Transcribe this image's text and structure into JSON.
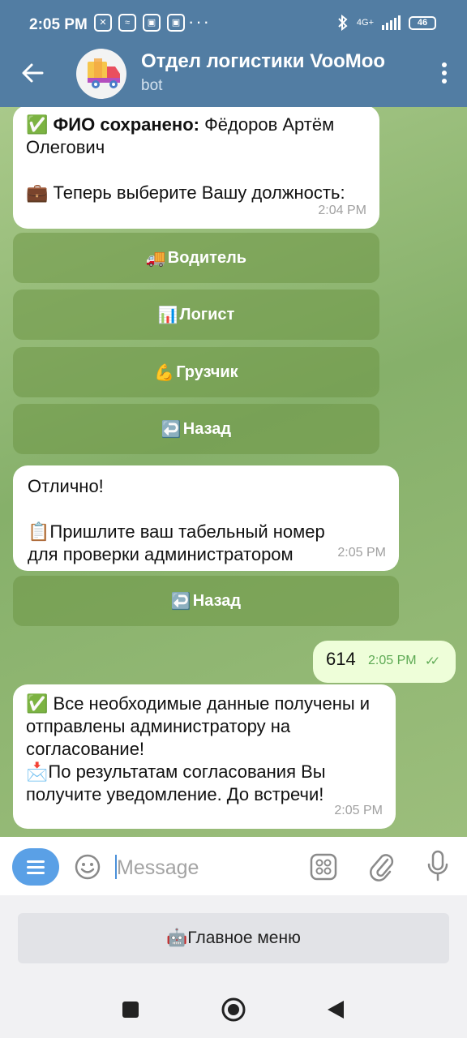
{
  "status_bar": {
    "time": "2:05 PM",
    "network": "4G+",
    "battery": "46"
  },
  "header": {
    "title": "Отдел логистики VooMoo",
    "subtitle": "bot"
  },
  "messages": {
    "m1": {
      "line1_bold": "ФИО сохранено:",
      "line1_rest": " Фёдоров Артём Олегович",
      "line2": "Теперь выберите Вашу должность:",
      "time": "2:04 PM",
      "buttons": [
        "Водитель",
        "Логист",
        "Грузчик",
        "Назад"
      ]
    },
    "m2": {
      "line1": "Отлично!",
      "line2": "Пришлите ваш табельный номер для проверки администратором",
      "time": "2:05 PM",
      "button": "Назад"
    },
    "m3": {
      "text": "614",
      "time": "2:05 PM"
    },
    "m4": {
      "line1": "Все необходимые данные получены и отправлены администратору на согласование!",
      "line2": "По результатам согласования Вы получите уведомление. До встречи!",
      "time": "2:05 PM"
    }
  },
  "input": {
    "placeholder": "Message"
  },
  "reply_keyboard": {
    "main_menu": "Главное меню"
  },
  "icons": {
    "back": "arrow-left-icon",
    "more": "more-vertical-icon",
    "menu": "menu-icon",
    "emoji": "emoji-icon",
    "commands": "grid-icon",
    "attach": "paperclip-icon",
    "mic": "microphone-icon"
  },
  "colors": {
    "header": "#527da3",
    "menu_button": "#5aa0e6",
    "outgoing_bubble": "#eefed9"
  }
}
